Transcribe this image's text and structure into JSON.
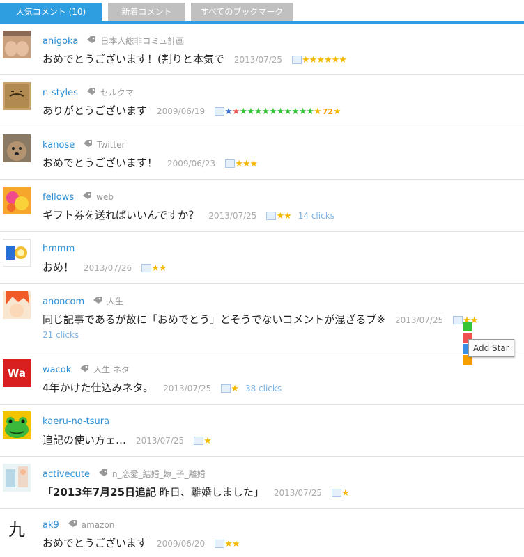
{
  "tabs": [
    {
      "label": "人気コメント (10)"
    },
    {
      "label": "新着コメント"
    },
    {
      "label": "すべてのブックマーク"
    }
  ],
  "rows": [
    {
      "user": "anigoka",
      "tags": "日本人総非コミュ計画",
      "comment": "おめでとうございます！(割りと本気で",
      "date": "2013/07/25",
      "stars": "★★★★★★",
      "clicks": ""
    },
    {
      "user": "n-styles",
      "tags": "セルクマ",
      "comment": "ありがとうございます",
      "date": "2009/06/19",
      "stars_blue": "★",
      "stars_red": "★",
      "stars_green": "★★★★★★★★★★",
      "stars": "★",
      "count": "72",
      "stars_tail": "★"
    },
    {
      "user": "kanose",
      "tags": "Twitter",
      "comment": "おめでとうございます！",
      "date": "2009/06/23",
      "stars": "★★★"
    },
    {
      "user": "fellows",
      "tags": "web",
      "comment": "ギフト券を送ればいいんですか？",
      "date": "2013/07/25",
      "stars": "★★",
      "clicks": "14 clicks"
    },
    {
      "user": "hmmm",
      "comment": "おめ！",
      "date": "2013/07/26",
      "stars": "★★"
    },
    {
      "user": "anoncom",
      "tags": "人生",
      "comment": "同じ記事であるが故に「おめでとう」とそうでないコメントが混ざるブ※",
      "date": "2013/07/25",
      "stars": "★★",
      "clicks": "21 clicks"
    },
    {
      "user": "wacok",
      "tags": "人生 ネタ",
      "comment": "4年かけた仕込みネタ。",
      "date": "2013/07/25",
      "stars": "★",
      "clicks": "38 clicks"
    },
    {
      "user": "kaeru-no-tsura",
      "comment": "追記の使い方ェ…",
      "date": "2013/07/25",
      "stars": "★"
    },
    {
      "user": "activecute",
      "tags": "n_恋愛_結婚_嫁_子_離婚",
      "comment_bold": "「2013年7月25日追記",
      "comment": " 昨日、離婚しました」",
      "date": "2013/07/25",
      "stars": "★"
    },
    {
      "user": "ak9",
      "tags": "amazon",
      "comment": "おめでとうございます",
      "date": "2009/06/20",
      "stars": "★★"
    }
  ],
  "avatars": {
    "wacok": "Wa",
    "ak9": "九"
  },
  "tooltip": "Add Star",
  "colors": {
    "accent": "#2e9ee0",
    "link": "#2a8fd6",
    "star": "#f5b800",
    "tab_inactive": "#c0c0c0"
  }
}
